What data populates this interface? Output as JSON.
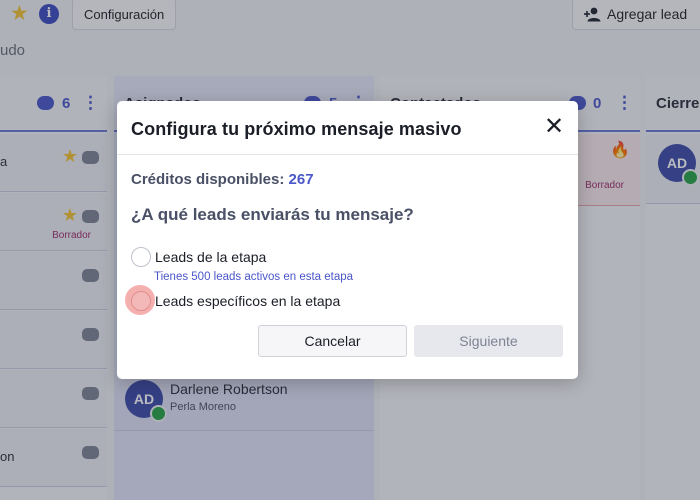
{
  "topbar": {
    "config_label": "Configuración",
    "add_lead_label": "Agregar lead",
    "ghost_text": "udo"
  },
  "columns": [
    {
      "id": "a",
      "title": "",
      "count": "6"
    },
    {
      "id": "b",
      "title": "Asignados",
      "count": "5"
    },
    {
      "id": "c",
      "title": "Contactados",
      "count": "0"
    },
    {
      "id": "d",
      "title": "Cierre",
      "count": ""
    }
  ],
  "col_a_cards": [
    {
      "text": "a"
    },
    {
      "text": "",
      "badge": "Borrador"
    },
    {
      "text": ""
    },
    {
      "text": ""
    },
    {
      "text": ""
    },
    {
      "text": "on"
    }
  ],
  "col_b_lead": {
    "initials": "AD",
    "name": "Darlene Robertson",
    "owner": "Perla Moreno"
  },
  "col_c_card": {
    "badge": "Borrador"
  },
  "col_d_lead": {
    "initials": "AD"
  },
  "modal": {
    "title": "Configura tu próximo mensaje masivo",
    "credits_label": "Créditos disponibles:",
    "credits_value": "267",
    "question": "¿A qué leads enviarás tu mensaje?",
    "option_1": "Leads de la etapa",
    "option_1_hint": "Tienes 500 leads activos en esta etapa",
    "option_2": "Leads específicos en la etapa",
    "cancel_label": "Cancelar",
    "next_label": "Siguiente"
  },
  "colors": {
    "accent": "#4957c9",
    "star": "#f1c232",
    "whatsapp": "#25a244",
    "draft": "#9c2d6b"
  }
}
